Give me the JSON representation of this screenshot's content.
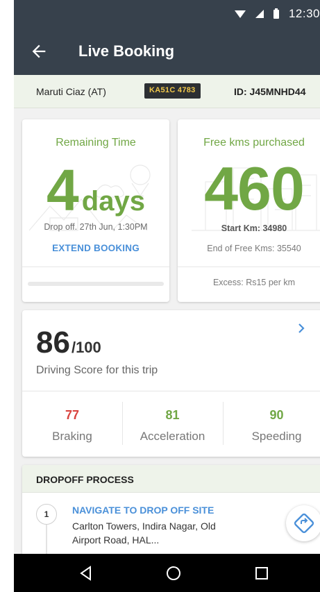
{
  "status_bar": {
    "time": "12:30"
  },
  "app_bar": {
    "title": "Live Booking"
  },
  "car": {
    "name": "Maruti Ciaz (AT)",
    "plate": "KA51C 4783",
    "id": "ID: J45MNHD44"
  },
  "remaining_time": {
    "label": "Remaining Time",
    "value": "4",
    "unit": "days",
    "dropoff": "Drop off. 27th Jun, 1:30PM",
    "extend_label": "EXTEND BOOKING"
  },
  "free_kms": {
    "label": "Free kms purchased",
    "value": "460",
    "start_km": "Start Km: 34980",
    "end_km": "End of Free Kms: 35540",
    "excess": "Excess: Rs15 per km"
  },
  "driving_score": {
    "score": "86",
    "out_of": "/100",
    "description": "Driving Score for this trip",
    "metrics": [
      {
        "value": "77",
        "label": "Braking",
        "color": "#d9443f"
      },
      {
        "value": "81",
        "label": "Acceleration",
        "color": "#71a745"
      },
      {
        "value": "90",
        "label": "Speeding",
        "color": "#71a745"
      }
    ]
  },
  "dropoff_process": {
    "title": "DROPOFF PROCESS",
    "steps": [
      {
        "number": "1",
        "title": "NAVIGATE TO DROP OFF SITE",
        "address": "Carlton Towers, Indira Nagar, Old Airport Road, HAL..."
      }
    ]
  },
  "icons": {
    "back": "arrow-left-icon",
    "chevron": "chevron-right-icon",
    "navigate": "navigation-icon",
    "nav_back": "triangle-back-icon",
    "nav_home": "circle-home-icon",
    "nav_recent": "square-recent-icon"
  },
  "colors": {
    "app_bar": "#37414c",
    "accent_green": "#71a745",
    "link_blue": "#4a90d9",
    "plate_bg": "#2c2f33",
    "plate_text": "#f0c74a"
  }
}
